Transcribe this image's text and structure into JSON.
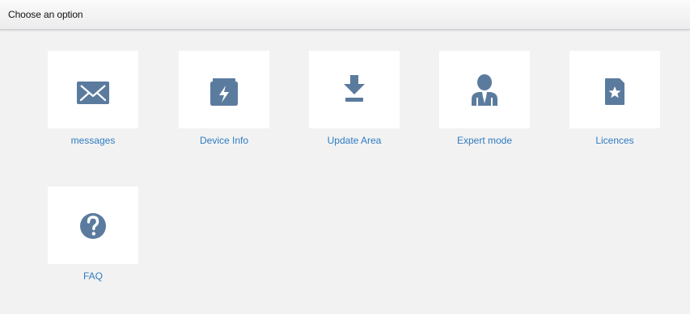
{
  "header": {
    "title": "Choose an option"
  },
  "accent_color": "#2f7cc1",
  "icon_color": "#5b7b9e",
  "options": [
    {
      "label": "messages",
      "icon": "envelope-icon"
    },
    {
      "label": "Device Info",
      "icon": "battery-charge-icon"
    },
    {
      "label": "Update Area",
      "icon": "download-icon"
    },
    {
      "label": "Expert mode",
      "icon": "user-tie-icon"
    },
    {
      "label": "Licences",
      "icon": "star-document-icon"
    },
    {
      "label": "FAQ",
      "icon": "question-circle-icon"
    }
  ]
}
